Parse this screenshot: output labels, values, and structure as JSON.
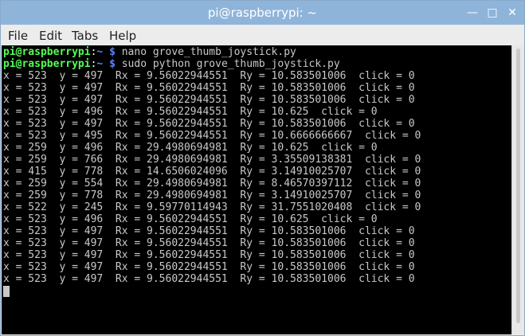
{
  "window": {
    "title": "pi@raspberrypi: ~"
  },
  "controls": {
    "minimize": "—",
    "maximize": "□",
    "close": "✕"
  },
  "menu": [
    "File",
    "Edit",
    "Tabs",
    "Help"
  ],
  "prompt": {
    "user_host": "pi@raspberrypi",
    "sep": ":",
    "path": "~",
    "symbol": "$"
  },
  "commands": [
    "nano grove_thumb_joystick.py",
    "sudo python grove_thumb_joystick.py"
  ],
  "output": [
    "x = 523  y = 497  Rx = 9.56022944551  Ry = 10.583501006  click = 0",
    "x = 523  y = 497  Rx = 9.56022944551  Ry = 10.583501006  click = 0",
    "x = 523  y = 497  Rx = 9.56022944551  Ry = 10.583501006  click = 0",
    "x = 523  y = 496  Rx = 9.56022944551  Ry = 10.625  click = 0",
    "x = 523  y = 497  Rx = 9.56022944551  Ry = 10.583501006  click = 0",
    "x = 523  y = 495  Rx = 9.56022944551  Ry = 10.6666666667  click = 0",
    "x = 259  y = 496  Rx = 29.4980694981  Ry = 10.625  click = 0",
    "x = 259  y = 766  Rx = 29.4980694981  Ry = 3.35509138381  click = 0",
    "x = 415  y = 778  Rx = 14.6506024096  Ry = 3.14910025707  click = 0",
    "x = 259  y = 554  Rx = 29.4980694981  Ry = 8.46570397112  click = 0",
    "x = 259  y = 778  Rx = 29.4980694981  Ry = 3.14910025707  click = 0",
    "x = 522  y = 245  Rx = 9.59770114943  Ry = 31.7551020408  click = 0",
    "x = 523  y = 496  Rx = 9.56022944551  Ry = 10.625  click = 0",
    "x = 523  y = 497  Rx = 9.56022944551  Ry = 10.583501006  click = 0",
    "x = 523  y = 497  Rx = 9.56022944551  Ry = 10.583501006  click = 0",
    "x = 523  y = 497  Rx = 9.56022944551  Ry = 10.583501006  click = 0",
    "x = 523  y = 497  Rx = 9.56022944551  Ry = 10.583501006  click = 0",
    "x = 523  y = 497  Rx = 9.56022944551  Ry = 10.583501006  click = 0"
  ]
}
